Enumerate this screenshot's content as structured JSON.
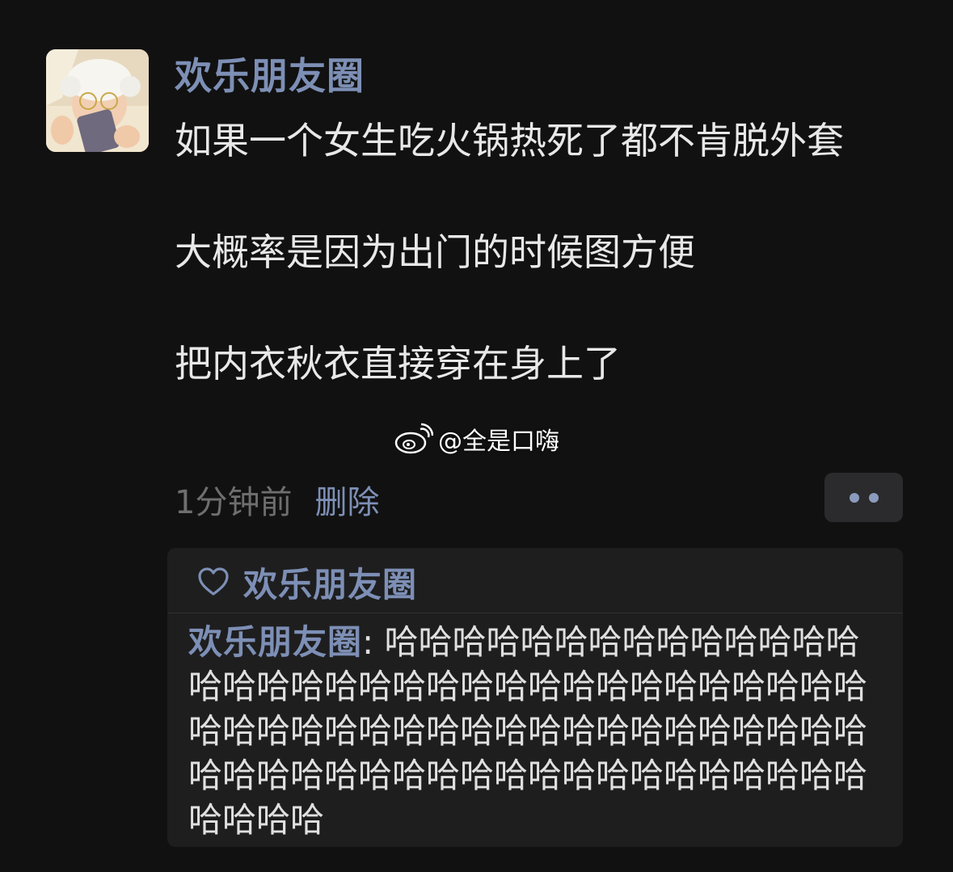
{
  "post": {
    "author": "欢乐朋友圈",
    "avatar_icon": "baby-avatar-photo",
    "paragraphs": [
      "如果一个女生吃火锅热死了都不肯脱外套",
      "大概率是因为出门的时候图方便",
      "把内衣秋衣直接穿在身上了"
    ],
    "time": "1分钟前",
    "delete_label": "删除",
    "more_icon": "more-dots-icon"
  },
  "watermark": {
    "icon": "weibo-logo-icon",
    "text": "@全是口嗨"
  },
  "reactions": {
    "like_icon": "heart-icon",
    "liker": "欢乐朋友圈",
    "comment_author": "欢乐朋友圈",
    "comment_separator": ": ",
    "comment_text": "哈哈哈哈哈哈哈哈哈哈哈哈哈哈哈哈哈哈哈哈哈哈哈哈哈哈哈哈哈哈哈哈哈哈哈哈哈哈哈哈哈哈哈哈哈哈哈哈哈哈哈哈哈哈哈哈哈哈哈哈哈哈哈哈哈哈哈哈哈哈哈哈哈哈哈哈哈哈"
  },
  "colors": {
    "background": "#111111",
    "name_link": "#7d8fb5",
    "body_text": "#e8e8e8",
    "muted_text": "#6e6e6e",
    "panel": "#1e1e1f"
  }
}
